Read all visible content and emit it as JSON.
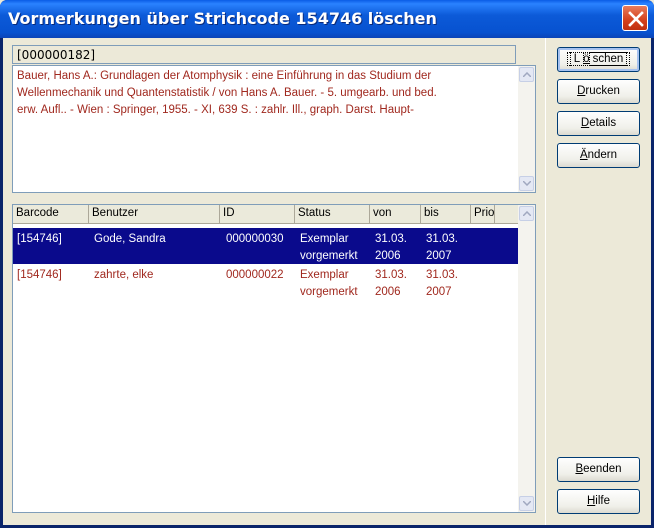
{
  "window": {
    "title": "Vormerkungen über Strichcode 154746 löschen"
  },
  "record": {
    "id": "[000000182]",
    "lines": [
      "Bauer, Hans A.: Grundlagen der Atomphysik : eine Einführung in das Studium der",
      "Wellenmechanik und Quantenstatistik / von Hans A. Bauer. - 5. umgearb. und bed.",
      "erw. Aufl.. - Wien  : Springer, 1955. - XI, 639 S.  : zahlr. Ill., graph. Darst. Haupt-"
    ]
  },
  "table": {
    "columns": [
      "Barcode",
      "Benutzer",
      "ID",
      "Status",
      "von",
      "bis",
      "Prio"
    ],
    "rows": [
      {
        "barcode": "[154746]",
        "benutzer": "Gode, Sandra",
        "id": "000000030",
        "status1": "Exemplar",
        "status2": "vorgemerkt",
        "von1": "31.03.",
        "von2": "2006",
        "bis1": "31.03.",
        "bis2": "2007",
        "selected": true
      },
      {
        "barcode": "[154746]",
        "benutzer": "zahrte, elke",
        "id": "000000022",
        "status1": "Exemplar",
        "status2": "vorgemerkt",
        "von1": "31.03.",
        "von2": "2006",
        "bis1": "31.03.",
        "bis2": "2007",
        "selected": false
      }
    ]
  },
  "buttons": {
    "loeschen": {
      "pre": "L",
      "u": "ö",
      "post": "schen"
    },
    "drucken": {
      "pre": "",
      "u": "D",
      "post": "rucken"
    },
    "details": {
      "pre": "",
      "u": "D",
      "post": "etails"
    },
    "aendern": {
      "pre": "",
      "u": "Ä",
      "post": "ndern"
    },
    "beenden": {
      "pre": "",
      "u": "B",
      "post": "eenden"
    },
    "hilfe": {
      "pre": "",
      "u": "H",
      "post": "ilfe"
    }
  },
  "colors": {
    "accent_text": "#a0281e",
    "selection": "#0a0a8c",
    "titlebar": "#0752d0"
  },
  "icons": {
    "close": "close-icon",
    "scroll_up": "chevron-up-icon",
    "scroll_down": "chevron-down-icon"
  }
}
